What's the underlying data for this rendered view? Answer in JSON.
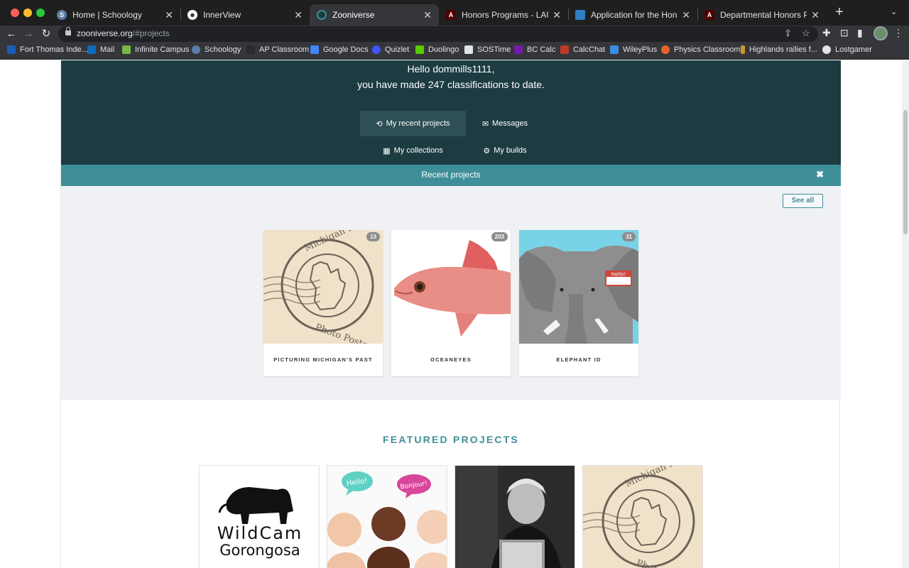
{
  "browser": {
    "tabs": [
      {
        "title": "Home | Schoology",
        "favicon": "schoology-icon"
      },
      {
        "title": "InnerView",
        "favicon": "innerview-icon"
      },
      {
        "title": "Zooniverse",
        "favicon": "zooniverse-icon",
        "active": true
      },
      {
        "title": "Honors Programs - LAUNCH",
        "favicon": "tamu-icon"
      },
      {
        "title": "Application for the Honors Prog",
        "favicon": "doc-icon"
      },
      {
        "title": "Departmental Honors Program",
        "favicon": "tamu-icon"
      }
    ],
    "url_host": "zooniverse.org",
    "url_path": "/#projects",
    "bookmarks": [
      {
        "label": "Fort Thomas Inde...",
        "icon": "ft-icon",
        "color": "#1a5fb4"
      },
      {
        "label": "Mail",
        "icon": "mail-icon",
        "color": "#0f6cbd"
      },
      {
        "label": "Infinite Campus",
        "icon": "campus-icon",
        "color": "#7ab648"
      },
      {
        "label": "Schoology",
        "icon": "schoology-icon",
        "color": "#5a7fa8"
      },
      {
        "label": "AP Classroom",
        "icon": "ap-icon",
        "color": "#2a2a2a"
      },
      {
        "label": "Google Docs",
        "icon": "docs-icon",
        "color": "#4285f4"
      },
      {
        "label": "Quizlet",
        "icon": "quizlet-icon",
        "color": "#4255ff"
      },
      {
        "label": "Duolingo",
        "icon": "duolingo-icon",
        "color": "#58cc02"
      },
      {
        "label": "SOSTime",
        "icon": "sostime-icon",
        "color": "#dfe3ea"
      },
      {
        "label": "BC Calc",
        "icon": "onenote-icon",
        "color": "#7719aa"
      },
      {
        "label": "CalcChat",
        "icon": "calcchat-icon",
        "color": "#c0392b"
      },
      {
        "label": "WileyPlus",
        "icon": "wiley-icon",
        "color": "#3b8de0"
      },
      {
        "label": "Physics Classroom",
        "icon": "physics-icon",
        "color": "#e8632b"
      },
      {
        "label": "Highlands rallies f...",
        "icon": "highlands-icon",
        "color": "#c79a2b"
      },
      {
        "label": "Lostgamer",
        "icon": "lostgamer-icon",
        "color": "#e3e3e3"
      }
    ]
  },
  "hero": {
    "greeting_line1": "Hello dommills1111,",
    "greeting_line2": "you have made 247 classifications to date.",
    "buttons": [
      {
        "label": "My recent projects",
        "icon": "history-icon",
        "active": true
      },
      {
        "label": "Messages",
        "icon": "envelope-icon"
      },
      {
        "label": "My collections",
        "icon": "grid-icon"
      },
      {
        "label": "My builds",
        "icon": "cog-icon"
      }
    ]
  },
  "recent": {
    "title": "Recent projects",
    "see_all": "See all",
    "projects": [
      {
        "name": "PICTURING MICHIGAN'S PAST",
        "count": "13"
      },
      {
        "name": "OCEANEYES",
        "count": "203"
      },
      {
        "name": "ELEPHANT ID",
        "count": "31"
      }
    ],
    "elephant_tag": "Hello!"
  },
  "featured": {
    "title": "FEATURED PROJECTS",
    "wildcam_line1": "WildCam",
    "wildcam_line2": "Gorongosa",
    "bubble_hello": "Hello!",
    "bubble_bonjour": "Bonjour!"
  },
  "stamp": {
    "top": "Michigan Real",
    "bottom": "Photo Postcards"
  },
  "colors": {
    "hero_bg": "#1c3c42",
    "accent_teal": "#3e8f99",
    "recent_bg": "#eff1f4"
  }
}
